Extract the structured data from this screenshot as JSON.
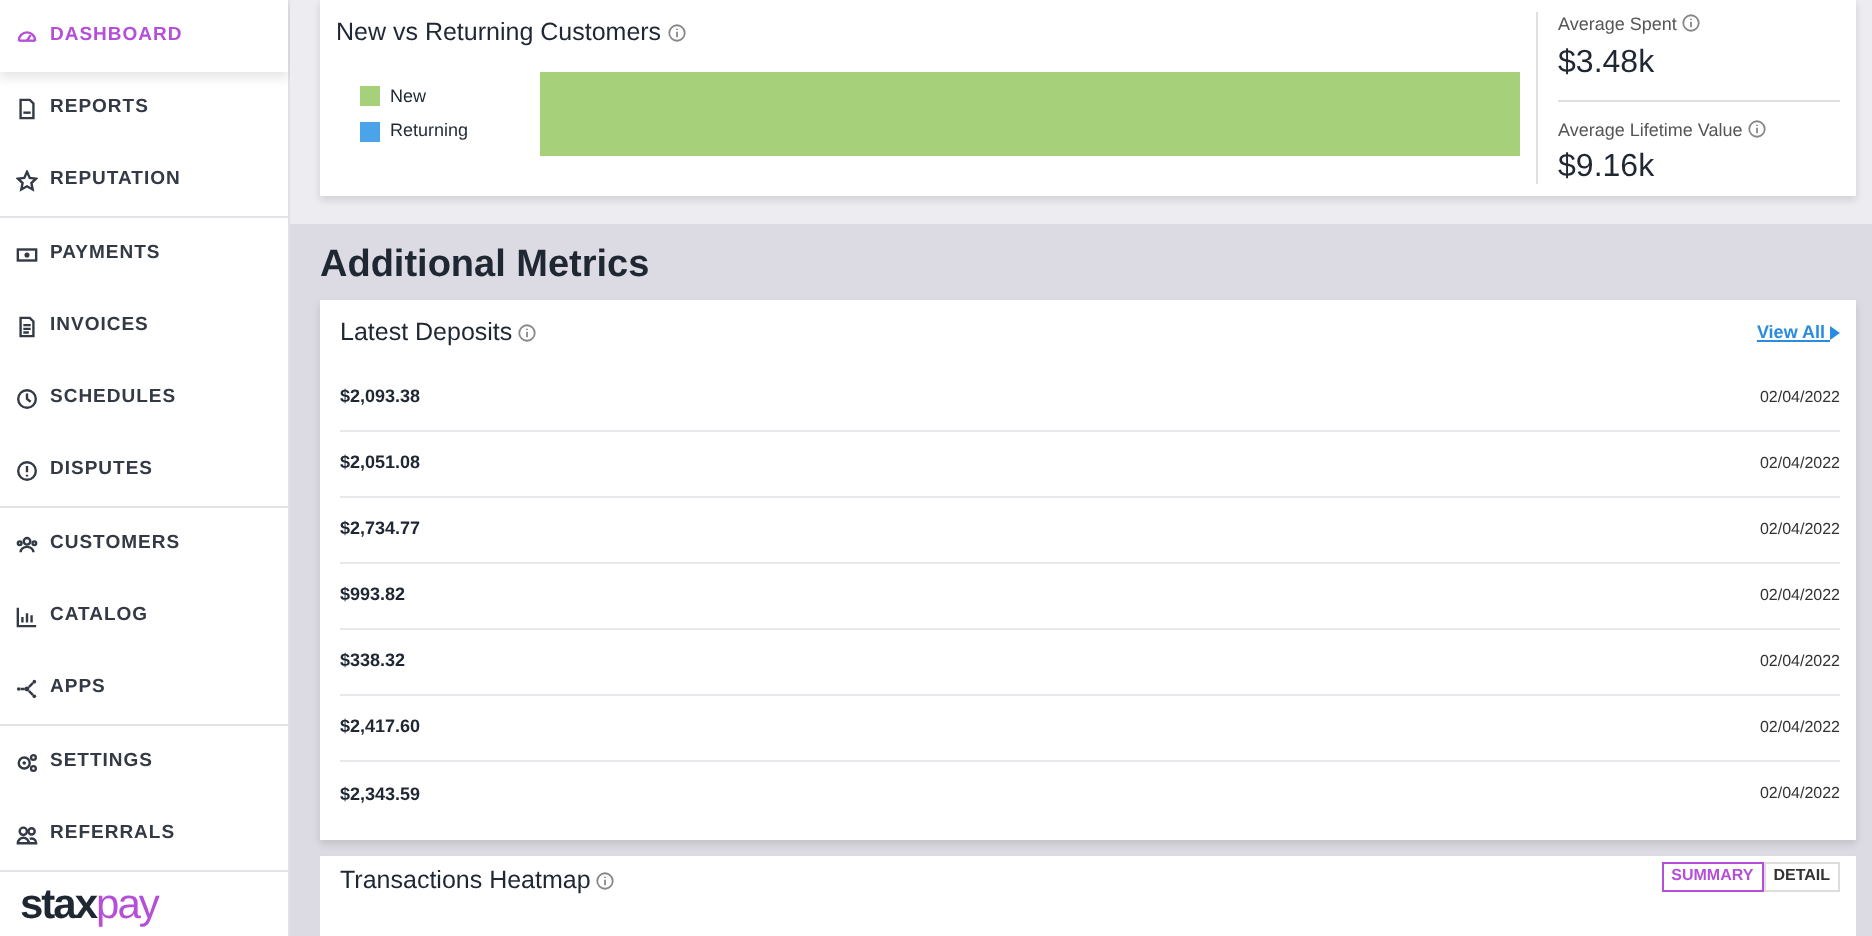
{
  "sidebar": {
    "groups": [
      {
        "items": [
          {
            "label": "DASHBOARD",
            "selected": true
          },
          {
            "label": "REPORTS",
            "selected": false
          },
          {
            "label": "REPUTATION",
            "selected": false
          }
        ]
      },
      {
        "items": [
          {
            "label": "PAYMENTS",
            "selected": false
          },
          {
            "label": "INVOICES",
            "selected": false
          },
          {
            "label": "SCHEDULES",
            "selected": false
          },
          {
            "label": "DISPUTES",
            "selected": false
          }
        ]
      },
      {
        "items": [
          {
            "label": "CUSTOMERS",
            "selected": false
          },
          {
            "label": "CATALOG",
            "selected": false
          },
          {
            "label": "APPS",
            "selected": false
          }
        ]
      },
      {
        "items": [
          {
            "label": "SETTINGS",
            "selected": false
          },
          {
            "label": "REFERRALS",
            "selected": false
          }
        ]
      }
    ],
    "logo": {
      "main": "stax",
      "suffix": "pay"
    }
  },
  "customers_card": {
    "title": "New vs Returning Customers",
    "legend": [
      {
        "label": "New",
        "color": "#a6d07a"
      },
      {
        "label": "Returning",
        "color": "#4ba3ea"
      }
    ],
    "stats": [
      {
        "label": "Average Spent",
        "value": "$3.48k"
      },
      {
        "label": "Average Lifetime Value",
        "value": "$9.16k"
      }
    ]
  },
  "section_title": "Additional Metrics",
  "deposits": {
    "title": "Latest Deposits",
    "link": "View All",
    "rows": [
      {
        "amount": "$2,093.38",
        "date": "02/04/2022"
      },
      {
        "amount": "$2,051.08",
        "date": "02/04/2022"
      },
      {
        "amount": "$2,734.77",
        "date": "02/04/2022"
      },
      {
        "amount": "$993.82",
        "date": "02/04/2022"
      },
      {
        "amount": "$338.32",
        "date": "02/04/2022"
      },
      {
        "amount": "$2,417.60",
        "date": "02/04/2022"
      },
      {
        "amount": "$2,343.59",
        "date": "02/04/2022"
      }
    ]
  },
  "heatmap": {
    "title": "Transactions Heatmap",
    "toggles": [
      {
        "label": "SUMMARY",
        "selected": true
      },
      {
        "label": "DETAIL",
        "selected": false
      }
    ]
  }
}
